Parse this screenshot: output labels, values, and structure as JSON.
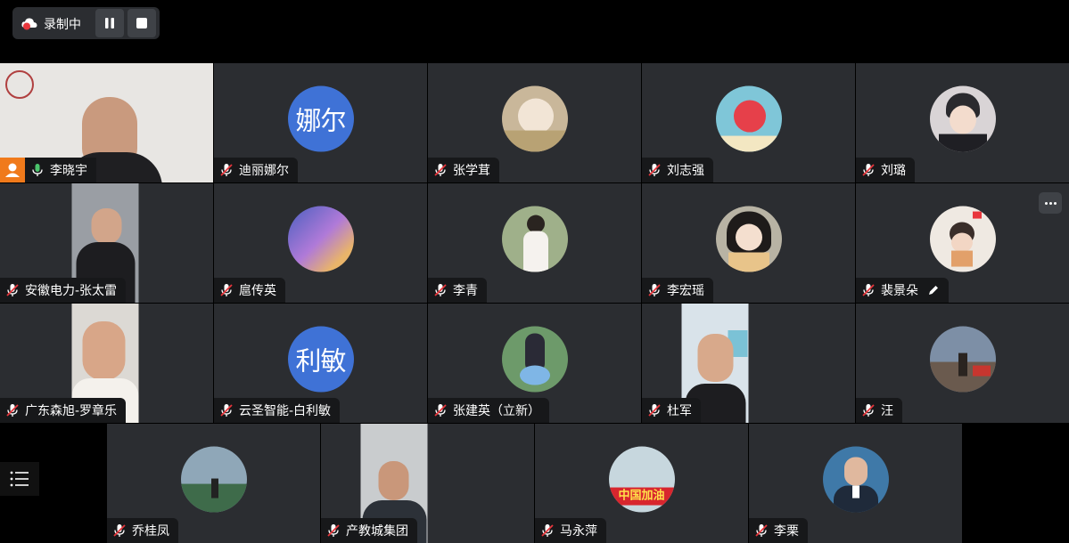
{
  "recording": {
    "label": "录制中"
  },
  "tiles": [
    {
      "name": "李晓宇",
      "avatar_text": "",
      "type": "video",
      "mic": "on",
      "active": true
    },
    {
      "name": "迪丽娜尔",
      "avatar_text": "娜尔",
      "type": "text",
      "mic": "muted"
    },
    {
      "name": "张学茸",
      "avatar_text": "",
      "type": "photo",
      "mic": "muted",
      "color": "#c9b79a"
    },
    {
      "name": "刘志强",
      "avatar_text": "",
      "type": "photo",
      "mic": "muted",
      "color": "#7fc6d8"
    },
    {
      "name": "刘璐",
      "avatar_text": "",
      "type": "photo",
      "mic": "muted",
      "color": "#d9d4d6"
    },
    {
      "name": "安徽电力-张太雷",
      "avatar_text": "",
      "type": "video",
      "mic": "muted"
    },
    {
      "name": "扈传英",
      "avatar_text": "",
      "type": "photo",
      "mic": "muted",
      "color": "#9a7cc8"
    },
    {
      "name": "李青",
      "avatar_text": "",
      "type": "photo",
      "mic": "muted",
      "color": "#9fb08a"
    },
    {
      "name": "李宏瑶",
      "avatar_text": "",
      "type": "photo",
      "mic": "muted",
      "color": "#b8b3a4"
    },
    {
      "name": "裴景朵",
      "avatar_text": "",
      "type": "photo",
      "mic": "muted",
      "color": "#efe9e2"
    },
    {
      "name": "广东森旭-罗章乐",
      "avatar_text": "",
      "type": "video",
      "mic": "muted"
    },
    {
      "name": "云圣智能-白利敏",
      "avatar_text": "利敏",
      "type": "text",
      "mic": "muted"
    },
    {
      "name": "张建英（立新）",
      "avatar_text": "",
      "type": "photo",
      "mic": "muted",
      "color": "#6d9a6a"
    },
    {
      "name": "杜军",
      "avatar_text": "",
      "type": "video",
      "mic": "muted"
    },
    {
      "name": "汪",
      "avatar_text": "",
      "type": "photo",
      "mic": "muted",
      "color": "#7d8fa6"
    },
    {
      "name": "乔桂凤",
      "avatar_text": "",
      "type": "photo",
      "mic": "muted",
      "color": "#8fa7b8"
    },
    {
      "name": "产教城集团",
      "avatar_text": "",
      "type": "video",
      "mic": "muted"
    },
    {
      "name": "马永萍",
      "avatar_text": "中国加油",
      "type": "photo",
      "mic": "muted",
      "color": "#c7d7de"
    },
    {
      "name": "李栗",
      "avatar_text": "",
      "type": "photo",
      "mic": "muted",
      "color": "#3f79a8"
    }
  ]
}
